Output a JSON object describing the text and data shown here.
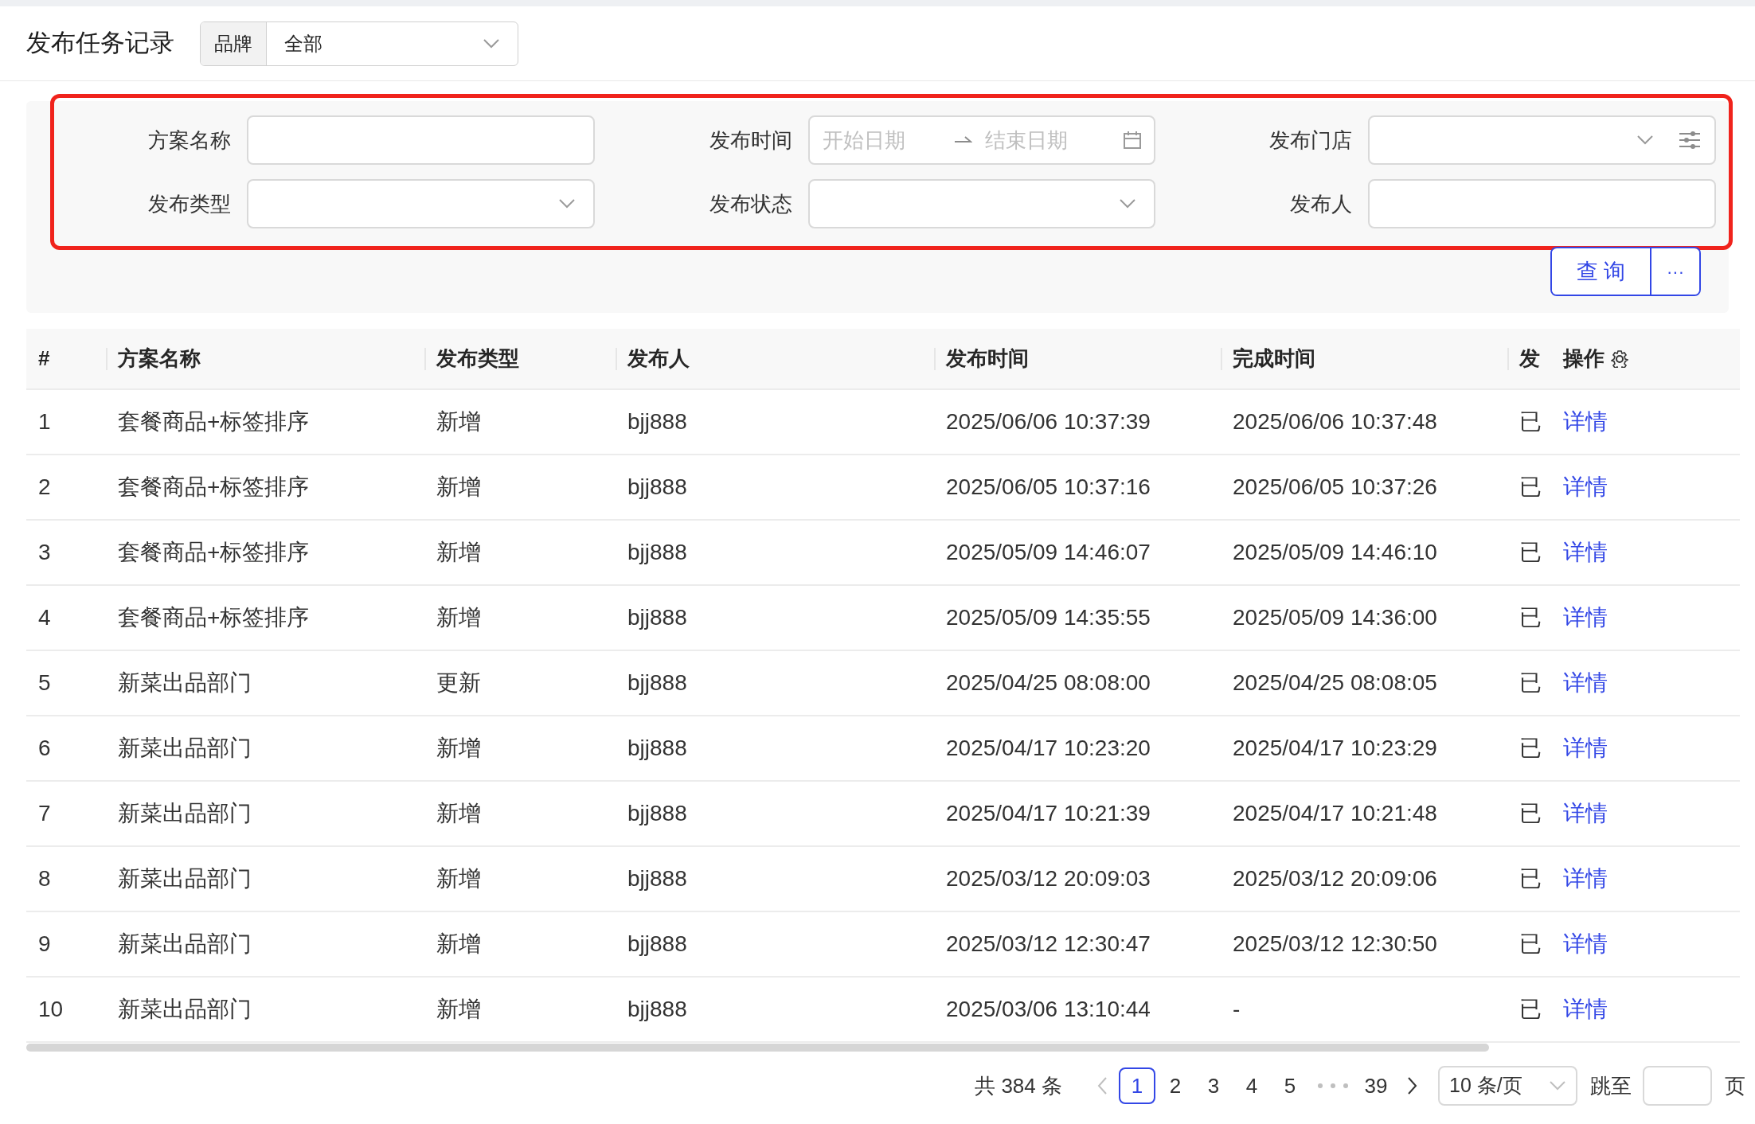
{
  "title": "发布任务记录",
  "brand_filter": {
    "label": "品牌",
    "value": "全部"
  },
  "filters": [
    {
      "kind": "text",
      "label": "方案名称"
    },
    {
      "kind": "date_range",
      "label": "发布时间",
      "start_placeholder": "开始日期",
      "end_placeholder": "结束日期"
    },
    {
      "kind": "store_select",
      "label": "发布门店"
    },
    {
      "kind": "select",
      "label": "发布类型"
    },
    {
      "kind": "select",
      "label": "发布状态"
    },
    {
      "kind": "text",
      "label": "发布人"
    }
  ],
  "highlighted_filters": true,
  "query_button": "查 询",
  "more_button": "···",
  "table": {
    "columns": [
      "#",
      "方案名称",
      "发布类型",
      "发布人",
      "发布时间",
      "完成时间",
      "发",
      "操作"
    ],
    "rows": [
      [
        "1",
        "套餐商品+标签排序",
        "新增",
        "bjj888",
        "2025/06/06 10:37:39",
        "2025/06/06 10:37:48",
        "已",
        "详情"
      ],
      [
        "2",
        "套餐商品+标签排序",
        "新增",
        "bjj888",
        "2025/06/05 10:37:16",
        "2025/06/05 10:37:26",
        "已",
        "详情"
      ],
      [
        "3",
        "套餐商品+标签排序",
        "新增",
        "bjj888",
        "2025/05/09 14:46:07",
        "2025/05/09 14:46:10",
        "已",
        "详情"
      ],
      [
        "4",
        "套餐商品+标签排序",
        "新增",
        "bjj888",
        "2025/05/09 14:35:55",
        "2025/05/09 14:36:00",
        "已",
        "详情"
      ],
      [
        "5",
        "新菜出品部门",
        "更新",
        "bjj888",
        "2025/04/25 08:08:00",
        "2025/04/25 08:08:05",
        "已",
        "详情"
      ],
      [
        "6",
        "新菜出品部门",
        "新增",
        "bjj888",
        "2025/04/17 10:23:20",
        "2025/04/17 10:23:29",
        "已",
        "详情"
      ],
      [
        "7",
        "新菜出品部门",
        "新增",
        "bjj888",
        "2025/04/17 10:21:39",
        "2025/04/17 10:21:48",
        "已",
        "详情"
      ],
      [
        "8",
        "新菜出品部门",
        "新增",
        "bjj888",
        "2025/03/12 20:09:03",
        "2025/03/12 20:09:06",
        "已",
        "详情"
      ],
      [
        "9",
        "新菜出品部门",
        "新增",
        "bjj888",
        "2025/03/12 12:30:47",
        "2025/03/12 12:30:50",
        "已",
        "详情"
      ],
      [
        "10",
        "新菜出品部门",
        "新增",
        "bjj888",
        "2025/03/06 13:10:44",
        "-",
        "已",
        "详情"
      ]
    ]
  },
  "pagination": {
    "total": "共 384 条",
    "pages": [
      {
        "label": "1",
        "selected": true
      },
      {
        "label": "2",
        "selected": false
      },
      {
        "label": "3",
        "selected": false
      },
      {
        "label": "4",
        "selected": false
      },
      {
        "label": "5",
        "selected": false
      },
      {
        "kind": "ellipsis"
      },
      {
        "label": "39",
        "selected": false
      }
    ],
    "page_size": "10 条/页",
    "jump_label": "跳至",
    "jump_suffix": "页"
  }
}
